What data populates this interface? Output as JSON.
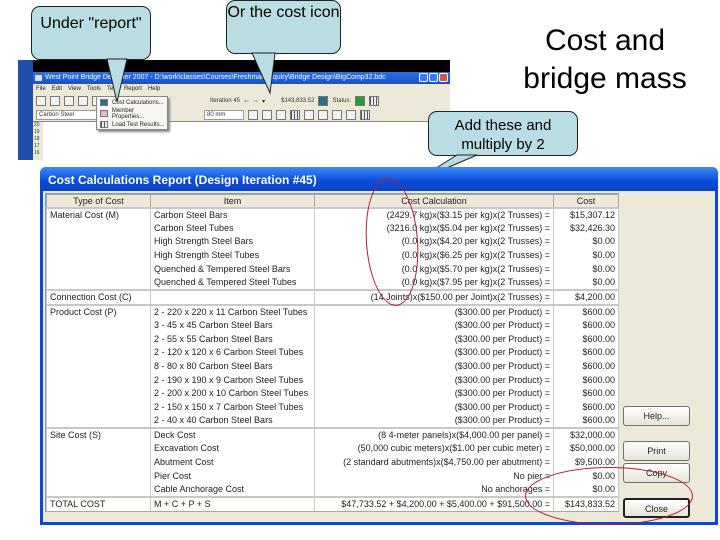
{
  "slide": {
    "title": "Cost and bridge mass"
  },
  "callouts": {
    "report_menu": "Under \"report\"",
    "cost_icon": "Or the cost icon",
    "add_multiply": "Add these and multiply by 2"
  },
  "app": {
    "window_title": "West Point Bridge Designer 2007 - D:\\work\\classes\\Courses\\Freshman Inquiry\\Bridge Design\\BigComp32.bdc",
    "menu": [
      "File",
      "Edit",
      "View",
      "Tools",
      "Test",
      "Report",
      "Help"
    ],
    "iteration_label": "Iteration 45",
    "cost_readout": "$143,833.52",
    "status_label": "Status:",
    "material_combo": "Carbon Steel",
    "size_combo": "80 mm",
    "ruler_ticks": [
      "20",
      "19",
      "18",
      "17",
      "16"
    ],
    "report_menu_items": [
      "Cost Calculations...",
      "Member Properties...",
      "Load Test Results..."
    ]
  },
  "dialog": {
    "title": "Cost Calculations Report (Design Iteration #45)",
    "columns": [
      "Type of Cost",
      "Item",
      "Cost Calculation",
      "Cost"
    ],
    "rows": [
      {
        "type": "Material Cost (M)",
        "item": "Carbon Steel Bars",
        "calc": "(2429.7 kg)x($3.15 per kg)x(2 Trusses) =",
        "cost": "$15,307.12",
        "group_start": true
      },
      {
        "type": "",
        "item": "Carbon Steel Tubes",
        "calc": "(3216.0 kg)x($5.04 per kg)x(2 Trusses) =",
        "cost": "$32,426.30"
      },
      {
        "type": "",
        "item": "High Strength Steel Bars",
        "calc": "(0.0 kg)x($4.20 per kg)x(2 Trusses) =",
        "cost": "$0.00"
      },
      {
        "type": "",
        "item": "High Strength Steel Tubes",
        "calc": "(0.0 kg)x($6.25 per kg)x(2 Trusses) =",
        "cost": "$0.00"
      },
      {
        "type": "",
        "item": "Quenched & Tempered Steel Bars",
        "calc": "(0.0 kg)x($5.70 per kg)x(2 Trusses) =",
        "cost": "$0.00"
      },
      {
        "type": "",
        "item": "Quenched & Tempered Steel Tubes",
        "calc": "(0.0 kg)x($7.95 per kg)x(2 Trusses) =",
        "cost": "$0.00"
      },
      {
        "type": "Connection Cost (C)",
        "item": "",
        "calc": "(14 Joints)x($150.00 per Joint)x(2 Trusses) =",
        "cost": "$4,200.00",
        "group_start": true
      },
      {
        "type": "Product Cost (P)",
        "item": "2 - 220 x 220 x 11 Carbon Steel Tubes",
        "calc": "($300.00 per Product) =",
        "cost": "$600.00",
        "group_start": true
      },
      {
        "type": "",
        "item": "3 - 45 x 45 Carbon Steel Bars",
        "calc": "($300.00 per Product) =",
        "cost": "$600.00"
      },
      {
        "type": "",
        "item": "2 - 55 x 55 Carbon Steel Bars",
        "calc": "($300.00 per Product) =",
        "cost": "$600.00"
      },
      {
        "type": "",
        "item": "2 - 120 x 120 x 6 Carbon Steel Tubes",
        "calc": "($300.00 per Product) =",
        "cost": "$600.00"
      },
      {
        "type": "",
        "item": "8 - 80 x 80 Carbon Steel Bars",
        "calc": "($300.00 per Product) =",
        "cost": "$600.00"
      },
      {
        "type": "",
        "item": "2 - 190 x 190 x 9 Carbon Steel Tubes",
        "calc": "($300.00 per Product) =",
        "cost": "$600.00"
      },
      {
        "type": "",
        "item": "2 - 200 x 200 x 10 Carbon Steel Tubes",
        "calc": "($300.00 per Product) =",
        "cost": "$600.00"
      },
      {
        "type": "",
        "item": "2 - 150 x 150 x 7 Carbon Steel Tubes",
        "calc": "($300.00 per Product) =",
        "cost": "$600.00"
      },
      {
        "type": "",
        "item": "2 - 40 x 40 Carbon Steel Bars",
        "calc": "($300.00 per Product) =",
        "cost": "$600.00"
      },
      {
        "type": "Site Cost (S)",
        "item": "Deck Cost",
        "calc": "(8 4-meter panels)x($4,000.00 per panel) =",
        "cost": "$32,000.00",
        "group_start": true
      },
      {
        "type": "",
        "item": "Excavation Cost",
        "calc": "(50,000 cubic meters)x($1.00 per cubic meter) =",
        "cost": "$50,000.00"
      },
      {
        "type": "",
        "item": "Abutment Cost",
        "calc": "(2 standard abutments)x($4,750.00 per abutment) =",
        "cost": "$9,500.00"
      },
      {
        "type": "",
        "item": "Pier Cost",
        "calc": "No pier =",
        "cost": "$0.00"
      },
      {
        "type": "",
        "item": "Cable Anchorage Cost",
        "calc": "No anchorages =",
        "cost": "$0.00"
      },
      {
        "type": "TOTAL COST",
        "item": "M + C + P + S",
        "calc": "$47,733.52 + $4,200.00 + $5,400.00 + $91,500.00 =",
        "cost": "$143,833.52",
        "group_start": true
      }
    ],
    "buttons": {
      "help": "Help...",
      "print": "Print",
      "copy": "Copy",
      "close": "Close"
    }
  },
  "colors": {
    "callout_fill": "#b9dde2",
    "dialog_title": "#0a48d8",
    "annotation_red": "#b0202a"
  }
}
